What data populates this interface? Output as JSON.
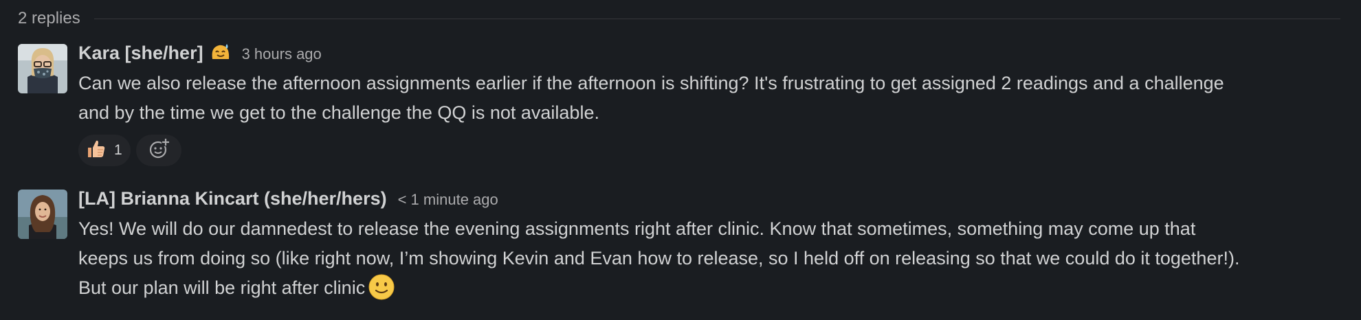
{
  "thread": {
    "replies_label": "2 replies"
  },
  "messages": [
    {
      "author": "Kara [she/her]",
      "status_icon": "sweat-smile-blob-icon",
      "timestamp": "3 hours ago",
      "lines": [
        "Can we also release the afternoon assignments earlier if the afternoon is shifting? It's frustrating to get assigned 2 readings and a challenge",
        "and by the time we get to the challenge the QQ is not available."
      ],
      "reactions": [
        {
          "emoji": "thumbs-up-icon",
          "count": "1"
        }
      ],
      "add_reaction_icon": "add-reaction-icon"
    },
    {
      "author": "[LA] Brianna Kincart (she/her/hers)",
      "timestamp": "< 1 minute ago",
      "lines": [
        "Yes! We will do our damnedest to release the evening assignments right after clinic. Know that sometimes, something may come up that",
        "keeps us from doing so (like right now, I’m showing Kevin and Evan how to release, so I held off on releasing so that we could do it together!).",
        "But our plan will be right after clinic"
      ],
      "trailing_emoji": "slightly-smiling-face-icon"
    }
  ],
  "colors": {
    "background": "#1a1d21",
    "text": "#d1d2d3",
    "muted": "#ababad",
    "reaction_bg": "#232529"
  }
}
